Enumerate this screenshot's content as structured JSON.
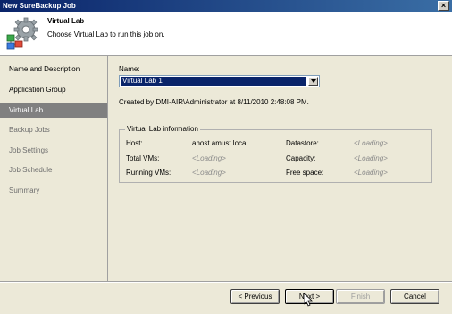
{
  "window": {
    "title": "New SureBackup Job",
    "close_glyph": "×"
  },
  "header": {
    "title": "Virtual Lab",
    "subtitle": "Choose Virtual Lab to run this job on.",
    "icon": "wizard-gear-icon"
  },
  "sidebar": {
    "items": [
      {
        "label": "Name and Description",
        "state": "normal"
      },
      {
        "label": "Application Group",
        "state": "normal"
      },
      {
        "label": "Virtual Lab",
        "state": "selected"
      },
      {
        "label": "Backup Jobs",
        "state": "disabled"
      },
      {
        "label": "Job Settings",
        "state": "disabled"
      },
      {
        "label": "Job Schedule",
        "state": "disabled"
      },
      {
        "label": "Summary",
        "state": "disabled"
      }
    ]
  },
  "main": {
    "name_label": "Name:",
    "name_value": "Virtual Lab 1",
    "created_by": "Created by DMI-AIR\\Administrator at 8/11/2010 2:48:08 PM.",
    "info": {
      "legend": "Virtual Lab information",
      "host_label": "Host:",
      "host_value": "ahost.amust.local",
      "total_vms_label": "Total VMs:",
      "total_vms_value": "<Loading>",
      "running_vms_label": "Running VMs:",
      "running_vms_value": "<Loading>",
      "datastore_label": "Datastore:",
      "datastore_value": "<Loading>",
      "capacity_label": "Capacity:",
      "capacity_value": "<Loading>",
      "free_space_label": "Free space:",
      "free_space_value": "<Loading>"
    }
  },
  "buttons": {
    "previous": "< Previous",
    "next": "Next >",
    "finish": "Finish",
    "cancel": "Cancel"
  },
  "colors": {
    "title_bar": "#0a246a",
    "selected_nav": "#808080",
    "dropdown_highlight": "#0a246a"
  }
}
